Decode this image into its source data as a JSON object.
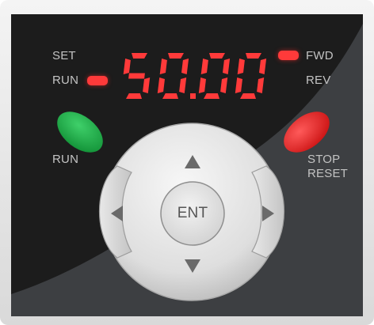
{
  "display": {
    "value": "50.00"
  },
  "labels": {
    "set": "SET",
    "run_indicator": "RUN",
    "fwd": "FWD",
    "rev": "REV",
    "run_button": "RUN",
    "stop_line1": "STOP",
    "stop_line2": "RESET",
    "ent": "ENT"
  },
  "indicators": {
    "run_led": "on",
    "fwd_led": "on"
  },
  "colors": {
    "panel_dark": "#1c1c1c",
    "panel_grey": "#3d3f42",
    "led_red": "#ff3a3a",
    "run_button": "#1ea34a",
    "stop_button": "#e02525",
    "label_grey": "#c3c3c3"
  },
  "icons": {
    "up": "triangle-up",
    "down": "triangle-down",
    "left": "triangle-left",
    "right": "triangle-right"
  }
}
